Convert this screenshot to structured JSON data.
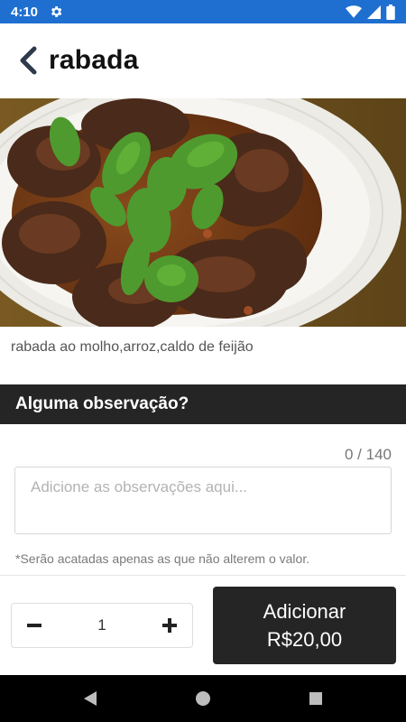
{
  "status_bar": {
    "time": "4:10",
    "icons": [
      "gear-icon",
      "wifi-icon",
      "signal-icon",
      "battery-icon"
    ]
  },
  "header": {
    "title": "rabada",
    "back_icon": "chevron-left-icon"
  },
  "dish": {
    "description": "rabada ao molho,arroz,caldo de feijão"
  },
  "observation": {
    "heading": "Alguma observação?",
    "counter": "0 / 140",
    "placeholder": "Adicione as observações aqui...",
    "value": "",
    "note": "*Serão acatadas apenas as que não alterem o valor."
  },
  "quantity": {
    "value": "1",
    "decrement_icon": "minus-icon",
    "increment_icon": "plus-icon"
  },
  "add_button": {
    "label": "Adicionar",
    "price": "R$20,00"
  },
  "nav_bar": {
    "icons": [
      "back-triangle-icon",
      "home-circle-icon",
      "recents-square-icon"
    ]
  },
  "colors": {
    "status_bar": "#1e6fd0",
    "dark": "#252525"
  }
}
